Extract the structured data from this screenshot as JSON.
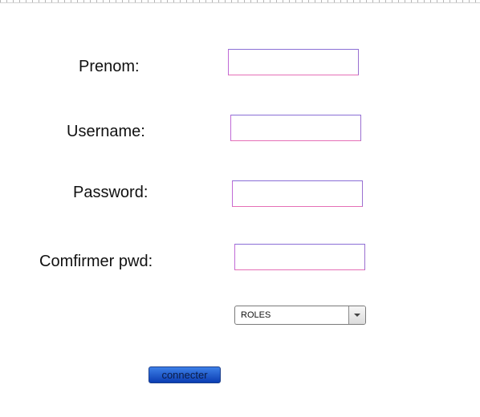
{
  "form": {
    "prenom_label": "Prenom:",
    "username_label": "Username:",
    "password_label": "Password:",
    "confirm_label": "Comfirmer pwd:",
    "prenom_value": "",
    "username_value": "",
    "password_value": "",
    "confirm_value": "",
    "roles_selected": "ROLES",
    "submit_label": "connecter"
  },
  "colors": {
    "button_gradient_top": "#3d80e8",
    "button_gradient_bottom": "#0b3db2",
    "input_border_top": "#8a6fd6",
    "input_border_bottom": "#e56fb6"
  },
  "icons": {
    "select_arrow": "chevron-down-icon"
  }
}
